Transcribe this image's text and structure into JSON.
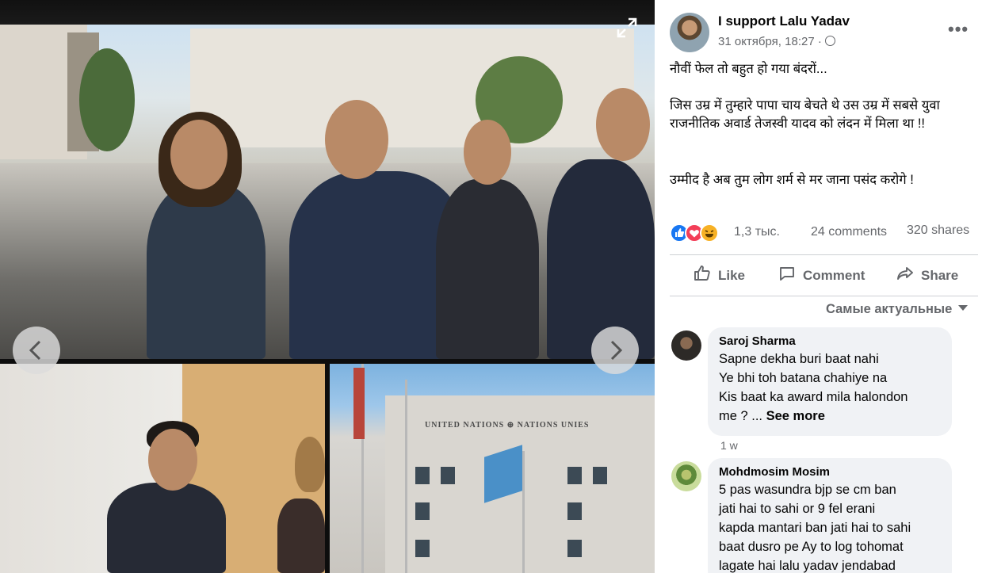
{
  "viewer": {
    "expand_icon": "expand-icon",
    "prev_icon": "chevron-left-icon",
    "next_icon": "chevron-right-icon",
    "un_sign_text": "UNITED NATIONS ⊕ NATIONS UNIES"
  },
  "post": {
    "page_name": "I support Lalu Yadav",
    "timestamp": "31 октября, 18:27 ·",
    "text_line1": "नौवीं फेल तो बहुत हो गया बंदरों...",
    "text_line2": "जिस उम्र में तुम्हारे पापा चाय बेचते थे उस उम्र में सबसे युवा राजनीतिक अवार्ड तेजस्वी यादव को लंदन में मिला था !!",
    "text_line3": "उम्मीद है अब तुम लोग शर्म से मर जाना पसंद करोगे !",
    "reaction_count": "1,3 тыс.",
    "comment_count": "24 comments",
    "share_count": "320 shares",
    "actions": {
      "like": "Like",
      "comment": "Comment",
      "share": "Share"
    },
    "sort_label": "Самые актуальные",
    "colors": {
      "accent": "#1877f2",
      "love": "#f33e58",
      "haha": "#f7b125",
      "muted": "#65676b",
      "bubble": "#f0f2f5"
    }
  },
  "comments": [
    {
      "author": "Saroj Sharma",
      "lines": [
        "Sapne dekha buri baat nahi",
        "Ye bhi toh batana chahiye na",
        "Kis baat ka award mila halondon",
        "me ? ... "
      ],
      "see_more": "See more",
      "age": "1 w"
    },
    {
      "author": "Mohdmosim Mosim",
      "lines": [
        "5 pas wasundra bjp se cm ban",
        "jati hai to sahi or 9 fel erani",
        "kapda mantari ban jati hai to sahi",
        "baat dusro pe Ay to log tohomat",
        "lagate hai lalu yadav jendabad"
      ]
    }
  ]
}
